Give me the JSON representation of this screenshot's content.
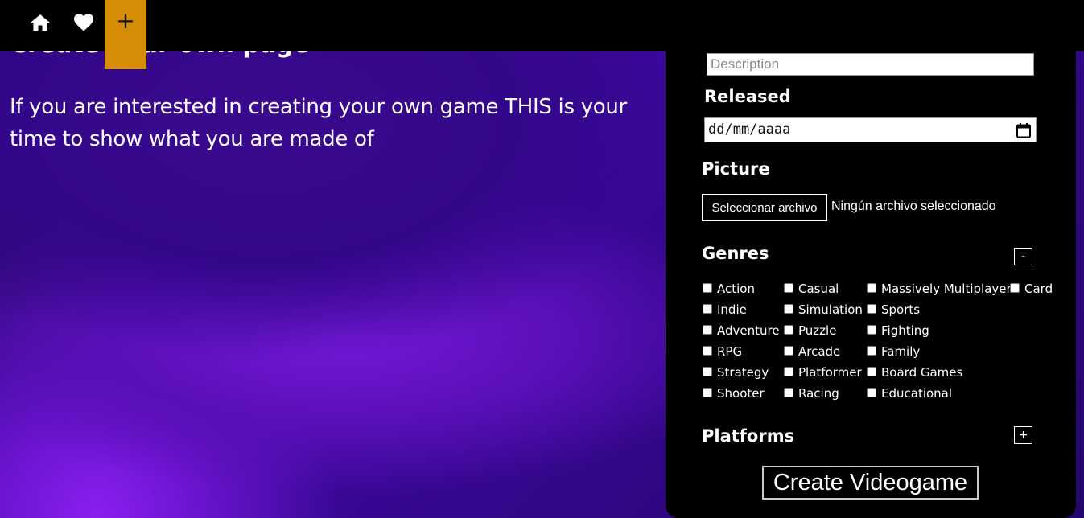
{
  "nav": {
    "home_icon": "home-icon",
    "favorites_icon": "heart-icon",
    "create_label": "+",
    "accent_color": "#d58c07"
  },
  "hero": {
    "title": "Create your own page",
    "text": "If you are interested in creating your own game THIS is your time to show what you are made of"
  },
  "form": {
    "description_placeholder": "Description",
    "released_label": "Released",
    "released_value": "dd/mm/aaaa",
    "picture_label": "Picture",
    "file_button_label": "Seleccionar archivo",
    "file_status": "Ningún archivo seleccionado",
    "genres_label": "Genres",
    "genres_toggle": "-",
    "genres": [
      [
        "Action",
        "Indie",
        "Adventure",
        "RPG",
        "Strategy",
        "Shooter"
      ],
      [
        "Casual",
        "Simulation",
        "Puzzle",
        "Arcade",
        "Platformer",
        "Racing"
      ],
      [
        "Massively Multiplayer",
        "Sports",
        "Fighting",
        "Family",
        "Board Games",
        "Educational"
      ],
      [
        "Card"
      ]
    ],
    "platforms_label": "Platforms",
    "platforms_toggle": "+",
    "submit_label": "Create Videogame"
  }
}
